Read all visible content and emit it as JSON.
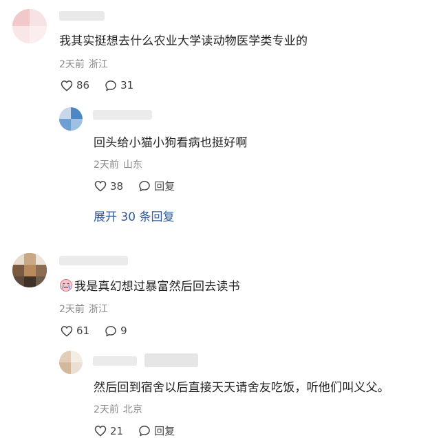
{
  "comments": [
    {
      "text": "我其实挺想去什么农业大学读动物医学类专业的",
      "time": "2天前",
      "location": "浙江",
      "likes": "86",
      "replies_count": "31",
      "reply": {
        "text": "回头给小猫小狗看病也挺好啊",
        "time": "2天前",
        "location": "山东",
        "likes": "38",
        "reply_label": "回复"
      },
      "expand_label": "展开 30 条回复"
    },
    {
      "text": "我是真幻想过暴富然后回去读书",
      "emoji": "crying-face-emoji",
      "time": "2天前",
      "location": "浙江",
      "likes": "61",
      "replies_count": "9",
      "reply": {
        "text": "然后回到宿舍以后直接天天请舍友吃饭，听他们叫义父。",
        "time": "2天前",
        "location": "北京",
        "likes": "21",
        "reply_label": "回复"
      }
    }
  ],
  "icons": {
    "like": "heart-outline-icon",
    "comment": "speech-bubble-icon"
  }
}
